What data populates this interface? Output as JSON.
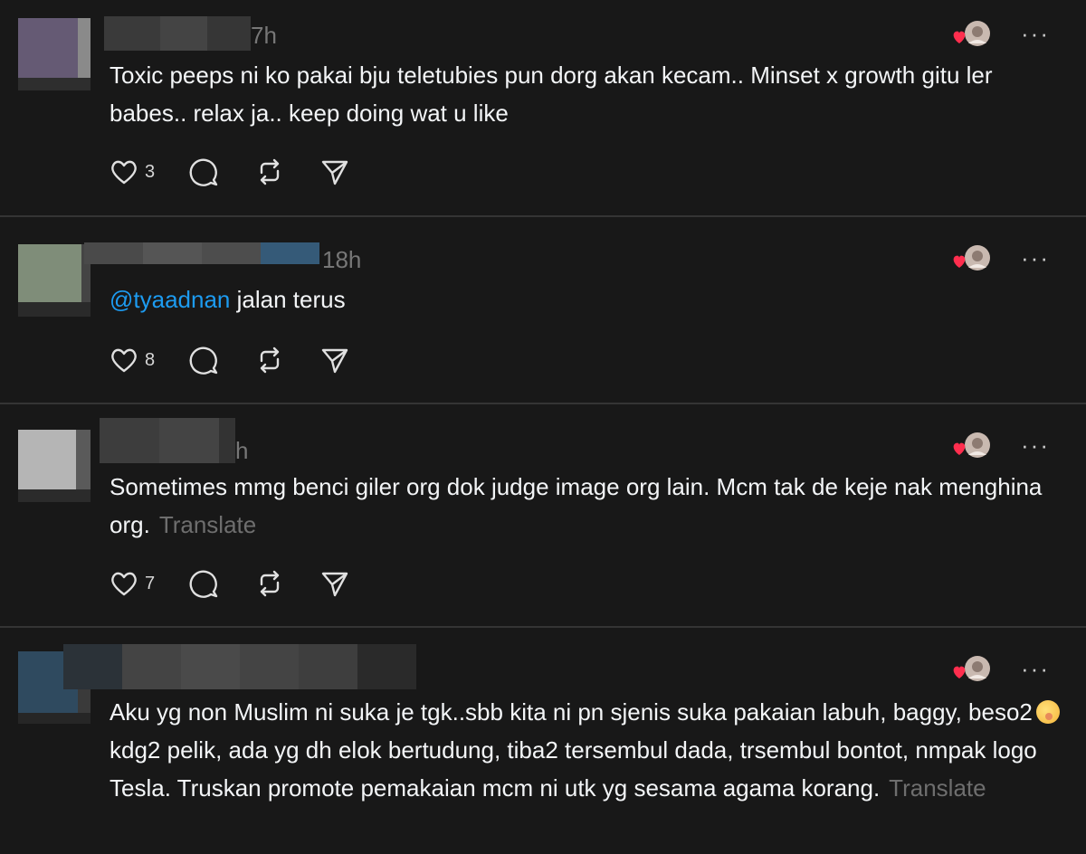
{
  "colors": {
    "background": "#181818",
    "text": "#f3f5f7",
    "muted": "#777777",
    "mention": "#1d9bf0",
    "heart": "#ff2e4e"
  },
  "icons": [
    "heart-icon",
    "comment-icon",
    "repost-icon",
    "share-icon",
    "liked-by-author-icon",
    "more-icon"
  ],
  "more_label": "···",
  "posts": [
    {
      "time": "7h",
      "text": "Toxic peeps ni ko pakai bju teletubies pun dorg akan kecam.. Minset x growth gitu ler babes.. relax ja.. keep doing wat u like",
      "likes": "3"
    },
    {
      "time": "18h",
      "mention": "@tyaadnan",
      "text": " jalan terus",
      "likes": "8"
    },
    {
      "time": "h",
      "text": "Sometimes mmg benci giler org dok judge image org lain. Mcm tak de keje nak menghina org.",
      "translate": "Translate",
      "likes": "7"
    },
    {
      "time": "",
      "text_before_emoji": "Aku yg non Muslim ni suka je tgk..sbb kita ni pn sjenis suka pakaian labuh, baggy, beso2",
      "text_after_emoji": "kdg2 pelik, ada yg dh elok bertudung, tiba2 tersembul dada, trsembul bontot, nmpak logo Tesla. Truskan promote pemakaian mcm ni utk yg sesama agama korang.",
      "translate": "Translate"
    }
  ]
}
